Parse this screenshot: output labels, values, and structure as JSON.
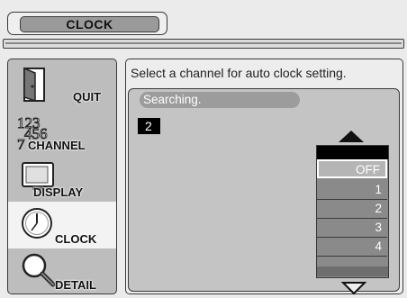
{
  "header": {
    "title": "CLOCK"
  },
  "sidebar": {
    "items": [
      {
        "label": "QUIT",
        "icon": "door-icon"
      },
      {
        "label": "CHANNEL",
        "icon": "numbers-icon"
      },
      {
        "label": "DISPLAY",
        "icon": "tv-icon"
      },
      {
        "label": "CLOCK",
        "icon": "clock-icon",
        "active": true
      },
      {
        "label": "DETAIL",
        "icon": "magnifier-icon"
      }
    ]
  },
  "main": {
    "instruction": "Select a channel for  auto clock setting.",
    "status": "Searching.",
    "current_channel": "2",
    "dropdown": {
      "options": [
        "OFF",
        "1",
        "2",
        "3",
        "4"
      ],
      "selected": "OFF"
    }
  }
}
